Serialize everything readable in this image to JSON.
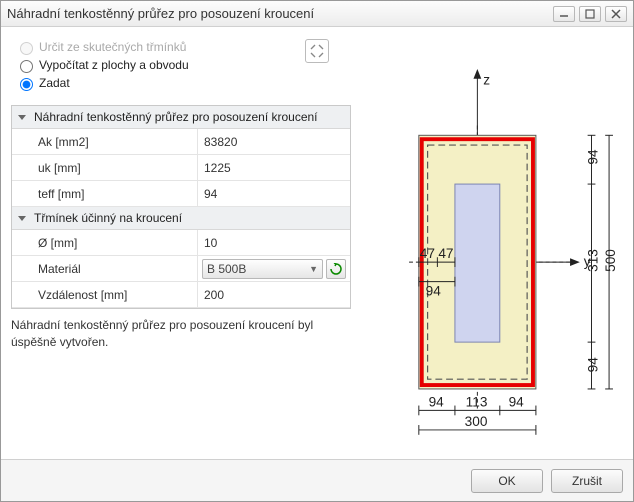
{
  "window": {
    "title": "Náhradní tenkostěnný průřez pro posouzení kroucení"
  },
  "radios": {
    "opt1": "Určit ze skutečných třmínků",
    "opt2": "Vypočítat z plochy a obvodu",
    "opt3": "Zadat",
    "selected": "opt3",
    "disabled": "opt1"
  },
  "sections": {
    "s1": {
      "title": "Náhradní tenkostěnný průřez pro posouzení kroucení"
    },
    "s2": {
      "title": "Třmínek účinný na kroucení"
    }
  },
  "fields": {
    "ak": {
      "label": "Ak [mm2]",
      "value": "83820"
    },
    "uk": {
      "label": "uk [mm]",
      "value": "1225"
    },
    "teff": {
      "label": "teff [mm]",
      "value": "94"
    },
    "diam": {
      "label": "Ø [mm]",
      "value": "10"
    },
    "material": {
      "label": "Materiál",
      "value": "B 500B"
    },
    "dist": {
      "label": "Vzdálenost [mm]",
      "value": "200"
    }
  },
  "status": {
    "line1": "Náhradní tenkostěnný průřez pro posouzení kroucení byl",
    "line2": "úspěšně vytvořen."
  },
  "buttons": {
    "ok": "OK",
    "cancel": "Zrušit"
  },
  "diagram": {
    "axis_z": "z",
    "axis_y": "y",
    "dims": {
      "top_94": "94",
      "mid_313": "313",
      "bot_94": "94",
      "right_total_top": "500",
      "left_47a": "47",
      "left_47b": "47",
      "left_94": "94",
      "b_94a": "94",
      "b_113": "113",
      "b_94b": "94",
      "b_300": "300"
    }
  },
  "chart_data": {
    "type": "diagram",
    "description": "Cross-section torsion replacement geometry",
    "outer_width_mm": 300,
    "outer_height_mm": 500,
    "teff_mm": 94,
    "inner_width_mm": 113,
    "inner_height_mm": 313,
    "wall_offsets_x_mm": [
      94,
      113,
      94
    ],
    "wall_offsets_y_mm": [
      94,
      313,
      94
    ],
    "centerline_offset_mm": 47,
    "Ak_mm2": 83820,
    "uk_mm": 1225
  }
}
